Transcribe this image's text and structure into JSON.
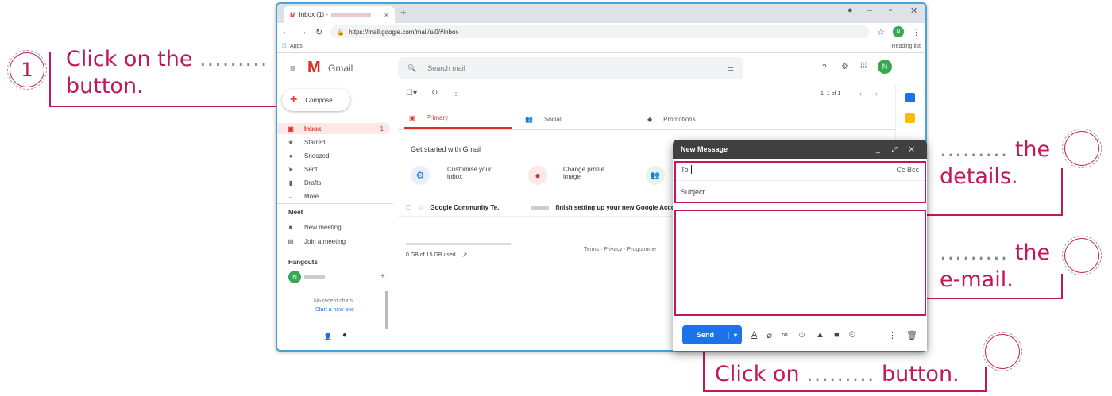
{
  "annotations": {
    "step1_number": "1",
    "step1_text_a": "Click on the",
    "step1_text_b": "button.",
    "details_text_a": "the",
    "details_text_b": "details.",
    "email_text_a": "the",
    "email_text_b": "e-mail.",
    "send_text_a": "Click on",
    "send_text_b": "button.",
    "dots": "........."
  },
  "browser": {
    "tab_title": "Inbox (1) - ",
    "tab_close": "×",
    "new_tab": "+",
    "url": "https://mail.google.com/mail/u/0/#inbox",
    "apps_label": "Apps",
    "reading_list": "Reading list",
    "profile_initial": "N"
  },
  "gmail": {
    "logo_text": "Gmail",
    "search_placeholder": "Search mail",
    "compose_label": "Compose",
    "nav": [
      {
        "label": "Inbox",
        "count": "1"
      },
      {
        "label": "Starred"
      },
      {
        "label": "Snoozed"
      },
      {
        "label": "Sent"
      },
      {
        "label": "Drafts"
      },
      {
        "label": "More"
      }
    ],
    "meet_heading": "Meet",
    "meet_items": [
      "New meeting",
      "Join a meeting"
    ],
    "hangouts_heading": "Hangouts",
    "hangouts_user_initial": "N",
    "no_recent_chats": "No recent chats",
    "start_new": "Start a new one",
    "pagination": "1–1 of 1",
    "tabs": [
      "Primary",
      "Social",
      "Promotions"
    ],
    "get_started_title": "Get started with Gmail",
    "get_started_cards": [
      {
        "label": "Customise your inbox"
      },
      {
        "label": "Change profile image"
      }
    ],
    "email_row": {
      "sender": "Google Community Te.",
      "subject": "finish setting up your new Google Accou"
    },
    "storage": "0 GB of 15 GB used",
    "footer": "Terms · Privacy · Programme"
  },
  "compose": {
    "title": "New Message",
    "to_label": "To",
    "cc_bcc": "Cc Bcc",
    "subject_label": "Subject",
    "send_label": "Send"
  },
  "colors": {
    "accent": "#c2185b",
    "send": "#1a73e8",
    "window_border": "#4aa3d8"
  }
}
